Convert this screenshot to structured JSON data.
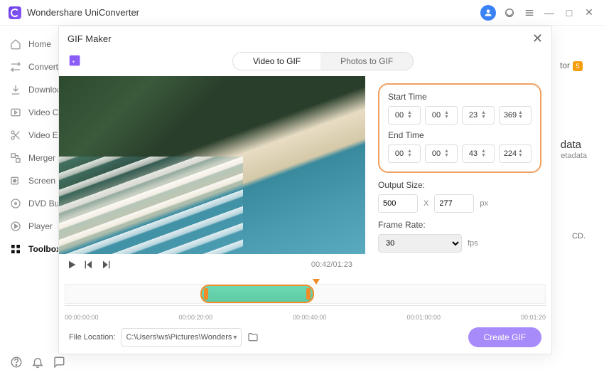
{
  "app": {
    "title": "Wondershare UniConverter"
  },
  "sidebar": {
    "items": [
      {
        "label": "Home"
      },
      {
        "label": "Converter"
      },
      {
        "label": "Downloader"
      },
      {
        "label": "Video Compressor"
      },
      {
        "label": "Video Editor"
      },
      {
        "label": "Merger"
      },
      {
        "label": "Screen Recorder"
      },
      {
        "label": "DVD Burner"
      },
      {
        "label": "Player"
      },
      {
        "label": "Toolbox"
      }
    ]
  },
  "background": {
    "tor_badge": "tor",
    "tor_num": "5",
    "data": "data",
    "etadata": "etadata",
    "cd": "CD."
  },
  "modal": {
    "title": "GIF Maker",
    "tabs": {
      "video": "Video to GIF",
      "photos": "Photos to GIF"
    },
    "timecount": "00:42/01:23",
    "start_label": "Start Time",
    "end_label": "End Time",
    "start": {
      "h": "00",
      "m": "00",
      "s": "23",
      "ms": "369"
    },
    "end": {
      "h": "00",
      "m": "00",
      "s": "43",
      "ms": "224"
    },
    "output_label": "Output Size:",
    "output": {
      "w": "500",
      "h": "277",
      "unit": "px"
    },
    "fr_label": "Frame Rate:",
    "fr_value": "30",
    "fr_unit": "fps",
    "ticks": [
      "00:00:00:00",
      "00:00:20:00",
      "00:00:40:00",
      "00:01:00:00",
      "00:01:20"
    ],
    "file_label": "File Location:",
    "file_path": "C:\\Users\\ws\\Pictures\\Wonders",
    "create": "Create GIF"
  }
}
